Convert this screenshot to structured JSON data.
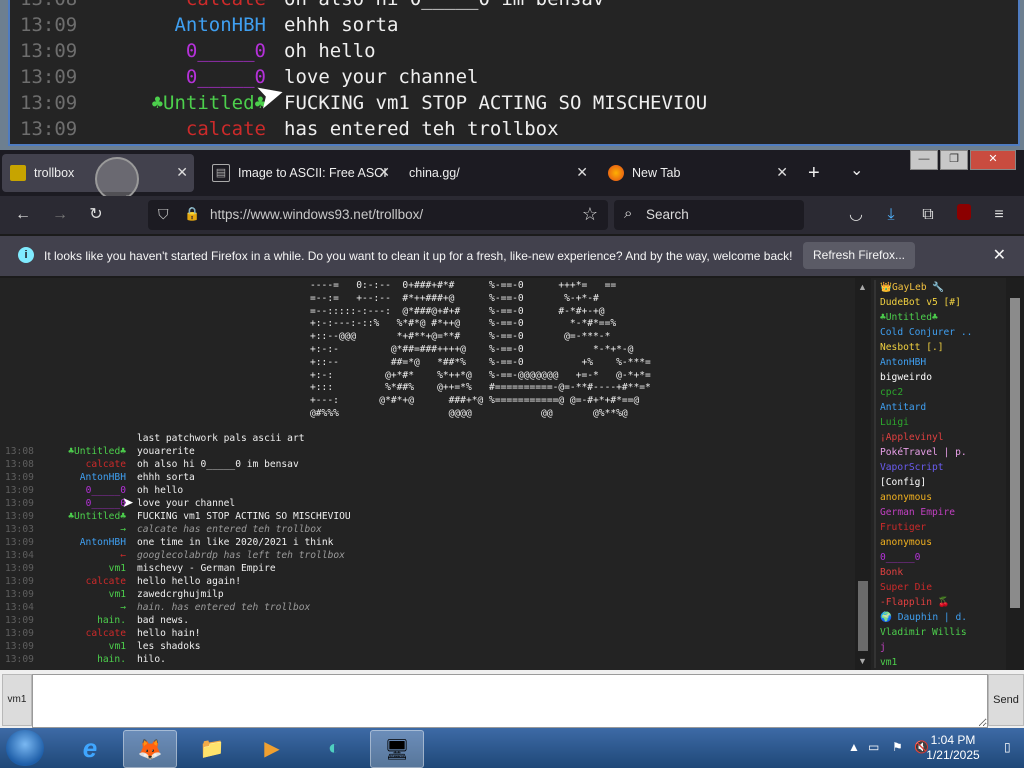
{
  "zoom_overlay": {
    "rows": [
      {
        "time": "13:08",
        "nick": "calcate",
        "nick_color": "#cc2a2a",
        "msg": "oh also hi 0_____0 im bensav"
      },
      {
        "time": "13:09",
        "nick": "AntonHBH",
        "nick_color": "#3f9ff0",
        "msg": "ehhh sorta"
      },
      {
        "time": "13:09",
        "nick": "0_____0",
        "nick_color": "#b531d9",
        "msg": "oh hello"
      },
      {
        "time": "13:09",
        "nick": "0_____0",
        "nick_color": "#b531d9",
        "msg": "love your channel"
      },
      {
        "time": "13:09",
        "nick": "♣Untitled♣",
        "nick_color": "#4ccf4c",
        "msg": "FUCKING vm1 STOP ACTING SO MISCHEVIOU"
      },
      {
        "time": "13:09",
        "nick": "calcate",
        "nick_color": "#cc2a2a",
        "msg": "has entered teh trollbox"
      }
    ]
  },
  "browser": {
    "tabs": [
      {
        "label": "trollbox",
        "icon": "trollbox-icon",
        "active": true
      },
      {
        "label": "Image to ASCII: Free ASCI",
        "icon": "page-icon",
        "active": false
      },
      {
        "label": "china.gg/",
        "icon": "",
        "active": false
      },
      {
        "label": "New Tab",
        "icon": "firefox-icon",
        "active": false
      }
    ],
    "new_tab_glyph": "+",
    "tab_list_glyph": "⌄",
    "url": "https://www.windows93.net/trollbox/",
    "search_placeholder": "Search",
    "notification": {
      "message": "It looks like you haven't started Firefox in a while. Do you want to clean it up for a fresh, like-new experience? And by the way, welcome back!",
      "button": "Refresh Firefox..."
    },
    "window_buttons": {
      "minimize": "—",
      "maximize": "❐",
      "close": "✕"
    }
  },
  "trollbox": {
    "ascii_art": "----=   0:-:--  0+###+#*#      %-==-0      +++*=   ==\n=--:=   +--:--  #*++###+@      %-==-0       %-+*-#\n=--:::::-:---:  @*###@+#+#     %-==-0      #-*#+-+@\n+:-:---:-::%   %*#*@ #*++@     %-==-0        *-*#*==%\n+::--@@@       *+#**+@=**#     %-==-0       @=-***-*\n+:-:-         @*##=###++++@    %-==-0            *-*+*-@\n+::--         ##=*@   *##*%    %-==-0          +%    %-***=\n+:-:         @+*#*    %*++*@   %-==-@@@@@@@   +=-*   @-*+*=\n+:::         %*##%    @++=*%   #==========-@=-**#----+#**=*\n+---:       @*#*+@      ###+*@ %===========@ @=-#+*+#*==@\n@#%%%                   @@@@            @@       @%**%@",
    "messages": [
      {
        "time": "",
        "nick": "",
        "nick_color": "#ffffff",
        "text": "last patchwork pals ascii art",
        "system": false
      },
      {
        "time": "13:08",
        "nick": "♣Untitled♣",
        "nick_color": "#4ccf4c",
        "text": "youarerite",
        "system": false
      },
      {
        "time": "13:08",
        "nick": "calcate",
        "nick_color": "#cc2a2a",
        "text": "oh also hi 0_____0 im bensav",
        "system": false
      },
      {
        "time": "13:09",
        "nick": "AntonHBH",
        "nick_color": "#3f9ff0",
        "text": "ehhh sorta",
        "system": false
      },
      {
        "time": "13:09",
        "nick": "0_____0",
        "nick_color": "#b531d9",
        "text": "oh hello",
        "system": false
      },
      {
        "time": "13:09",
        "nick": "0_____0",
        "nick_color": "#b531d9",
        "text": "love your channel",
        "system": false
      },
      {
        "time": "13:09",
        "nick": "♣Untitled♣",
        "nick_color": "#4ccf4c",
        "text": "FUCKING vm1 STOP ACTING SO MISCHEVIOU",
        "system": false
      },
      {
        "time": "13:03",
        "nick": "→",
        "nick_color": "#4ccf4c",
        "text": "calcate has entered teh trollbox",
        "system": true
      },
      {
        "time": "13:09",
        "nick": "AntonHBH",
        "nick_color": "#3f9ff0",
        "text": "one time in like 2020/2021 i think",
        "system": false
      },
      {
        "time": "13:04",
        "nick": "←",
        "nick_color": "#cc2a2a",
        "text": "googlecolabrdp has left teh trollbox",
        "system": true
      },
      {
        "time": "13:09",
        "nick": "vm1",
        "nick_color": "#4ccf4c",
        "text": "mischevy - German Empire",
        "system": false
      },
      {
        "time": "13:09",
        "nick": "calcate",
        "nick_color": "#cc2a2a",
        "text": "hello hello again!",
        "system": false
      },
      {
        "time": "13:09",
        "nick": "vm1",
        "nick_color": "#4ccf4c",
        "text": "zawedcrghujmilp",
        "system": false
      },
      {
        "time": "13:04",
        "nick": "→",
        "nick_color": "#4ccf4c",
        "text": "hain. has entered teh trollbox",
        "system": true
      },
      {
        "time": "13:09",
        "nick": "hain.",
        "nick_color": "#4ccf4c",
        "text": "bad news.",
        "system": false
      },
      {
        "time": "13:09",
        "nick": "calcate",
        "nick_color": "#cc2a2a",
        "text": "hello hain!",
        "system": false
      },
      {
        "time": "13:09",
        "nick": "vm1",
        "nick_color": "#4ccf4c",
        "text": "les shadoks",
        "system": false
      },
      {
        "time": "13:09",
        "nick": "hain.",
        "nick_color": "#4ccf4c",
        "text": "hilo.",
        "system": false
      }
    ],
    "users": [
      {
        "name": "👑GayLeb 🔧",
        "color": "#f0c040"
      },
      {
        "name": "DudeBot v5 [#]",
        "color": "#f0d040"
      },
      {
        "name": "♣Untitled♣",
        "color": "#4ccf4c"
      },
      {
        "name": "Cold Conjurer ..",
        "color": "#3f9ff0"
      },
      {
        "name": "Nesbott [.]",
        "color": "#f0d040"
      },
      {
        "name": "AntonHBH",
        "color": "#3f9ff0"
      },
      {
        "name": "bigweirdo",
        "color": "#ffffff"
      },
      {
        "name": "cpc2",
        "color": "#2da82d"
      },
      {
        "name": "Antitard",
        "color": "#3f9ff0"
      },
      {
        "name": "Luigi",
        "color": "#2da82d"
      },
      {
        "name": "¡Applevinyl",
        "color": "#e04040"
      },
      {
        "name": "PokéTravel | p.",
        "color": "#e8a0e8"
      },
      {
        "name": "VaporScript",
        "color": "#6a5cf0"
      },
      {
        "name": "[Config]",
        "color": "#ffffff"
      },
      {
        "name": "anonymous",
        "color": "#f0b020"
      },
      {
        "name": "German Empire",
        "color": "#c040c0"
      },
      {
        "name": "Frutiger",
        "color": "#cc2a2a"
      },
      {
        "name": "anonymous",
        "color": "#f0b020"
      },
      {
        "name": "0_____0",
        "color": "#b531d9"
      },
      {
        "name": "Bonk",
        "color": "#e04040"
      },
      {
        "name": "Super Die",
        "color": "#cc2a2a"
      },
      {
        "name": "-Flapplin 🍒",
        "color": "#e04040"
      },
      {
        "name": "🌍 Dauphin | d.",
        "color": "#3f9ff0"
      },
      {
        "name": "Vladimir Willis",
        "color": "#4ccf4c"
      },
      {
        "name": "j",
        "color": "#c040c0"
      },
      {
        "name": "vm1",
        "color": "#4ccf4c"
      }
    ],
    "nick_label": "vm1",
    "input_value": "",
    "send_label": "Send"
  },
  "taskbar": {
    "apps": [
      {
        "name": "internet-explorer-icon",
        "glyph": "e"
      },
      {
        "name": "firefox-icon",
        "glyph": "🦊"
      },
      {
        "name": "file-explorer-icon",
        "glyph": "📁"
      },
      {
        "name": "media-player-icon",
        "glyph": "▶"
      },
      {
        "name": "app-icon",
        "glyph": "◐"
      },
      {
        "name": "remote-desktop-icon",
        "glyph": "🖥"
      }
    ],
    "time": "1:04 PM",
    "date": "1/21/2025"
  }
}
